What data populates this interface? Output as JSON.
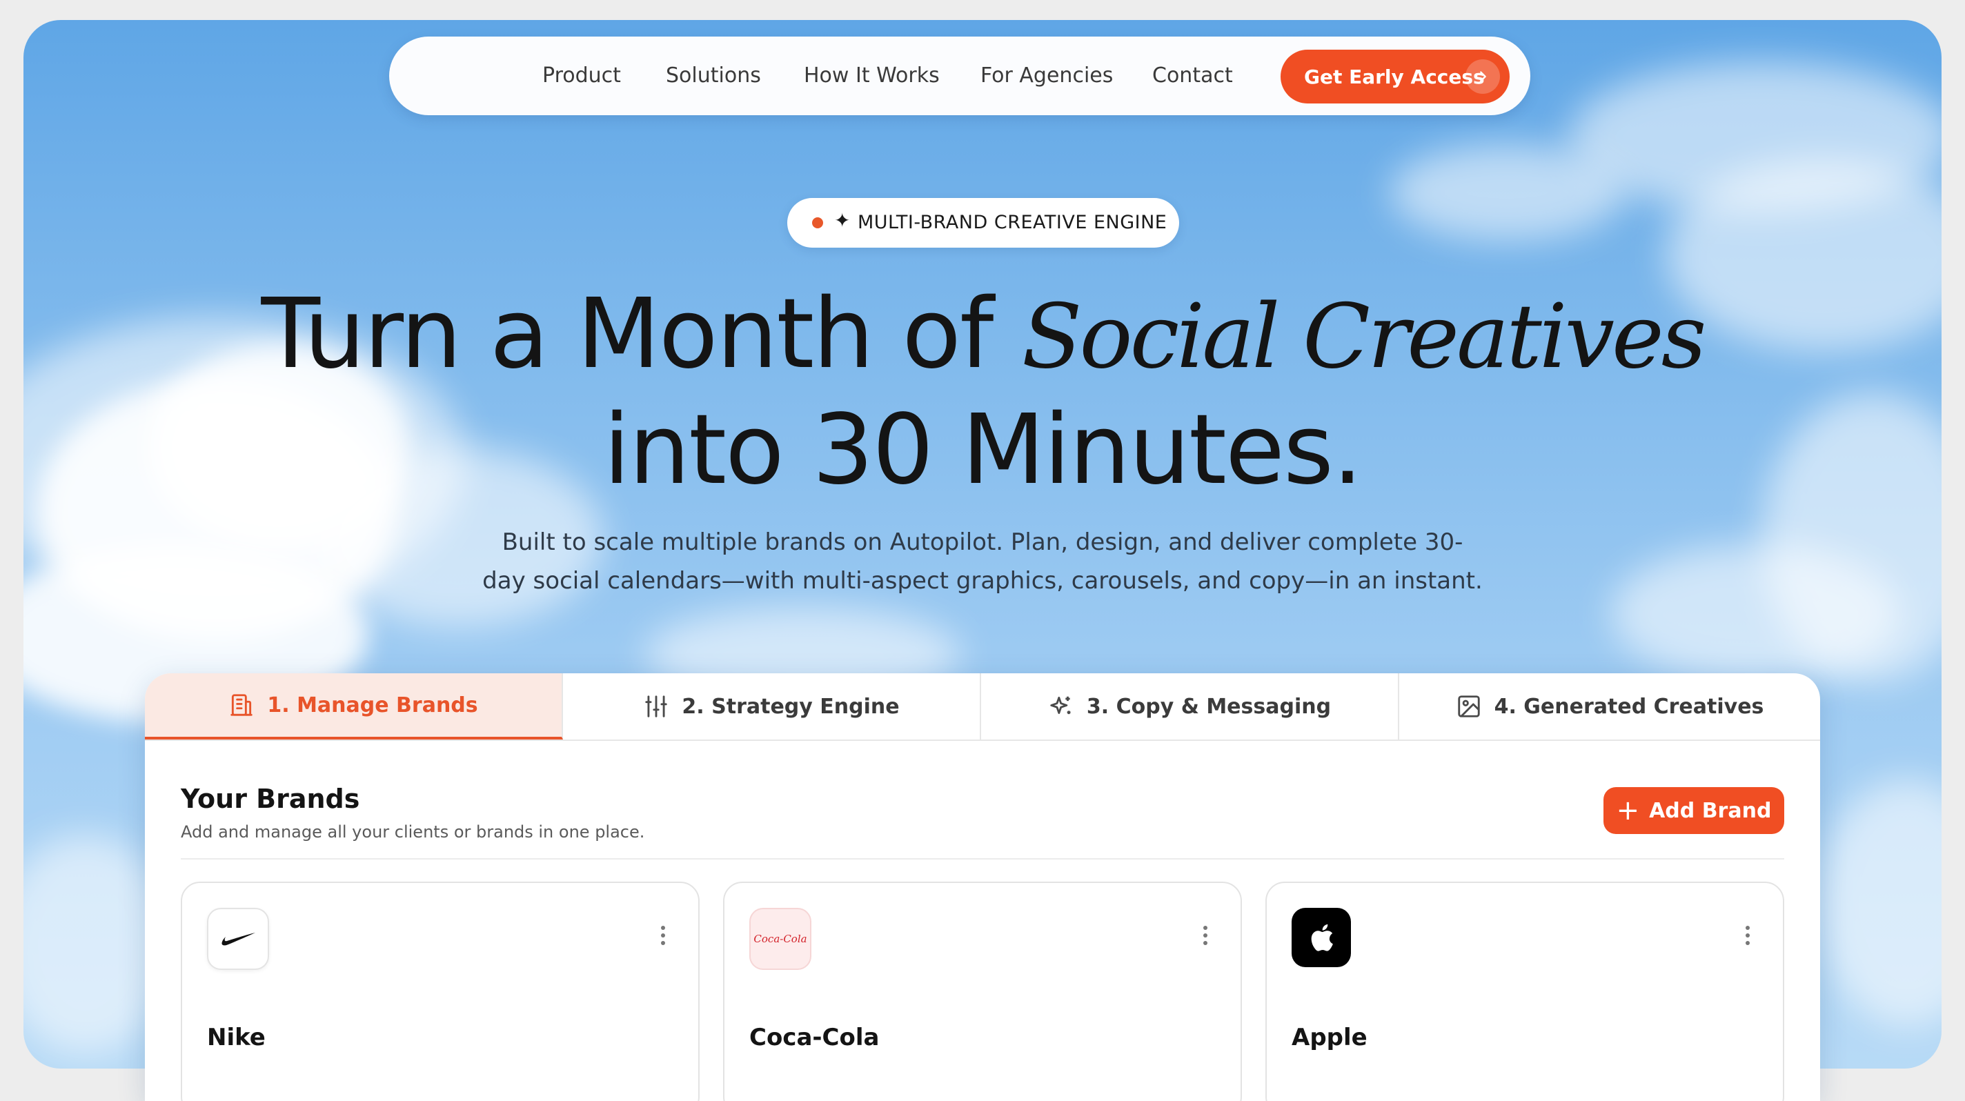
{
  "nav": {
    "links": [
      "Product",
      "Solutions",
      "How It Works",
      "For Agencies",
      "Contact"
    ],
    "cta_label": "Get Early Access",
    "cta_icon": "chevron-right-icon"
  },
  "badge": {
    "text": "MULTI-BRAND CREATIVE ENGINE",
    "spark": "✦"
  },
  "hero": {
    "line1_plain": "Turn a Month of ",
    "line1_italic": "Social Creatives",
    "line2": "into 30 Minutes.",
    "sub1": "Built to scale multiple brands on Autopilot. Plan, design, and deliver complete 30-",
    "sub2": "day social calendars—with multi-aspect graphics, carousels, and copy—in an instant."
  },
  "tabs": [
    {
      "label": "1. Manage Brands",
      "icon": "building-icon",
      "active": true
    },
    {
      "label": "2. Strategy Engine",
      "icon": "sliders-icon",
      "active": false
    },
    {
      "label": "3. Copy & Messaging",
      "icon": "sparkles-icon",
      "active": false
    },
    {
      "label": "4. Generated Creatives",
      "icon": "image-icon",
      "active": false
    }
  ],
  "brands": {
    "title": "Your Brands",
    "subtitle": "Add and manage all your clients or brands in one place.",
    "add_label": "Add Brand",
    "cards": [
      {
        "name": "Nike",
        "logo": "nike-swoosh-logo"
      },
      {
        "name": "Coca-Cola",
        "logo": "coca-cola-logo",
        "logo_text": "Coca-Cola"
      },
      {
        "name": "Apple",
        "logo": "apple-logo"
      }
    ]
  },
  "colors": {
    "accent": "#f04e23",
    "active_tab_bg": "#fbe9e3",
    "sky": "#7fb9ec"
  }
}
